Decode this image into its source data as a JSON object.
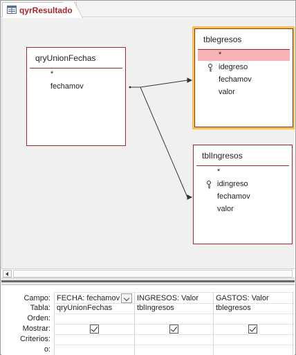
{
  "tab": {
    "title": "qyrResultado",
    "icon": "query-icon"
  },
  "tables": [
    {
      "title": "qryUnionFechas",
      "fields": [
        "*",
        "fechamov"
      ]
    },
    {
      "title": "tblegresos",
      "fields": [
        "*",
        "idegreso",
        "fechamov",
        "valor"
      ],
      "selected_field": "*",
      "key_field": "idegreso"
    },
    {
      "title": "tblIngresos",
      "fields": [
        "*",
        "idingreso",
        "fechamov",
        "valor"
      ],
      "key_field": "idingreso"
    }
  ],
  "grid": {
    "row_labels": [
      "Campo:",
      "Tabla:",
      "Orden:",
      "Mostrar:",
      "Criterios:",
      "o:"
    ],
    "columns": [
      {
        "campo": "FECHA: fechamov",
        "tabla": "qryUnionFechas",
        "mostrar": true
      },
      {
        "campo": "INGRESOS: Valor",
        "tabla": "tblIngresos",
        "mostrar": true
      },
      {
        "campo": "GASTOS: Valor",
        "tabla": "tblegresos",
        "mostrar": true
      }
    ]
  },
  "colors": {
    "table_border": "#a4262c",
    "selection_outline": "#f4c34a",
    "selected_row": "#f7b3b8",
    "tab_text": "#a4262c"
  }
}
